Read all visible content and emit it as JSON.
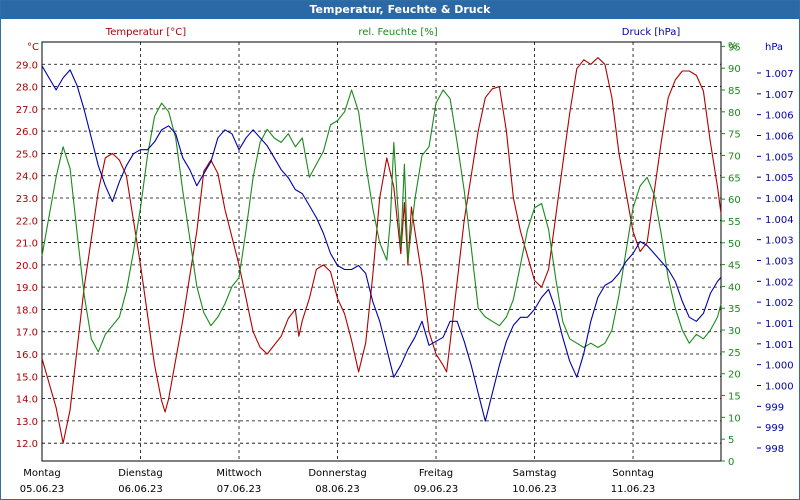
{
  "window": {
    "title": "Temperatur, Feuchte & Druck"
  },
  "colors": {
    "temperature": "#b00000",
    "humidity": "#1a8a1a",
    "pressure": "#0000aa",
    "grid": "#000000",
    "titlebar": "#2a69a5"
  },
  "chart_data": {
    "type": "line",
    "grid": true,
    "series": [
      {
        "name": "Temperatur [°C]",
        "axis": "left",
        "unit": "°C",
        "points": [
          [
            0,
            15.8
          ],
          [
            2,
            13.6
          ],
          [
            3,
            12.0
          ],
          [
            4,
            13.5
          ],
          [
            6,
            19.0
          ],
          [
            8,
            23.3
          ],
          [
            9,
            24.8
          ],
          [
            10,
            25.0
          ],
          [
            11,
            24.7
          ],
          [
            12,
            24.0
          ],
          [
            14,
            20.0
          ],
          [
            16,
            15.5
          ],
          [
            17,
            13.9
          ],
          [
            17.5,
            13.4
          ],
          [
            18,
            14.0
          ],
          [
            20,
            17.5
          ],
          [
            22,
            21.5
          ],
          [
            23,
            24.2
          ],
          [
            24,
            24.7
          ],
          [
            25,
            24.1
          ],
          [
            26,
            22.5
          ],
          [
            28,
            20.0
          ],
          [
            30,
            17.0
          ],
          [
            31,
            16.3
          ],
          [
            32,
            16.0
          ],
          [
            33,
            16.4
          ],
          [
            34,
            16.8
          ],
          [
            35,
            17.6
          ],
          [
            36,
            18.0
          ],
          [
            36.5,
            16.8
          ],
          [
            37,
            17.5
          ],
          [
            38,
            18.5
          ],
          [
            39,
            19.8
          ],
          [
            40,
            20.0
          ],
          [
            41,
            19.7
          ],
          [
            42,
            18.5
          ],
          [
            43,
            17.8
          ],
          [
            44,
            16.6
          ],
          [
            45,
            15.2
          ],
          [
            46,
            16.5
          ],
          [
            47,
            19.5
          ],
          [
            48,
            23.0
          ],
          [
            49,
            24.8
          ],
          [
            50,
            23.5
          ],
          [
            51,
            20.5
          ],
          [
            51.5,
            22.8
          ],
          [
            52,
            20.0
          ],
          [
            52.5,
            22.6
          ],
          [
            53,
            21.5
          ],
          [
            54,
            19.5
          ],
          [
            55,
            17.0
          ],
          [
            56,
            16.0
          ],
          [
            57,
            15.5
          ],
          [
            57.5,
            15.2
          ],
          [
            58,
            16.5
          ],
          [
            60,
            22.0
          ],
          [
            62,
            26.0
          ],
          [
            63,
            27.5
          ],
          [
            64,
            27.9
          ],
          [
            65,
            28.0
          ],
          [
            66,
            26.0
          ],
          [
            67,
            23.0
          ],
          [
            68,
            21.5
          ],
          [
            70,
            19.3
          ],
          [
            71,
            19.0
          ],
          [
            72,
            19.8
          ],
          [
            74,
            24.5
          ],
          [
            75,
            26.8
          ],
          [
            76,
            28.8
          ],
          [
            77,
            29.2
          ],
          [
            78,
            29.0
          ],
          [
            79,
            29.3
          ],
          [
            80,
            29.0
          ],
          [
            81,
            27.5
          ],
          [
            82,
            25.0
          ],
          [
            84,
            21.5
          ],
          [
            85,
            20.6
          ],
          [
            86,
            21.0
          ],
          [
            88,
            25.5
          ],
          [
            89,
            27.5
          ],
          [
            90,
            28.3
          ],
          [
            91,
            28.7
          ],
          [
            92,
            28.7
          ],
          [
            93,
            28.5
          ],
          [
            94,
            27.8
          ],
          [
            95,
            25.5
          ],
          [
            96,
            23.5
          ],
          [
            96.5,
            22.3
          ]
        ]
      },
      {
        "name": "rel. Feuchte [%]",
        "axis": "right1",
        "unit": "%",
        "points": [
          [
            0,
            47
          ],
          [
            1,
            56
          ],
          [
            2,
            65
          ],
          [
            3,
            72
          ],
          [
            4,
            67
          ],
          [
            5,
            52
          ],
          [
            6,
            38
          ],
          [
            7,
            28
          ],
          [
            8,
            25
          ],
          [
            9,
            29
          ],
          [
            10,
            31
          ],
          [
            11,
            33
          ],
          [
            12,
            39
          ],
          [
            13,
            48
          ],
          [
            14,
            58
          ],
          [
            15,
            70
          ],
          [
            16,
            79
          ],
          [
            17,
            82
          ],
          [
            18,
            80
          ],
          [
            19,
            74
          ],
          [
            20,
            62
          ],
          [
            21,
            51
          ],
          [
            22,
            40
          ],
          [
            23,
            34
          ],
          [
            24,
            31
          ],
          [
            25,
            33
          ],
          [
            26,
            36
          ],
          [
            27,
            40
          ],
          [
            28,
            42
          ],
          [
            29,
            53
          ],
          [
            30,
            65
          ],
          [
            31,
            73
          ],
          [
            32,
            76
          ],
          [
            33,
            74
          ],
          [
            34,
            73
          ],
          [
            35,
            75
          ],
          [
            36,
            72
          ],
          [
            37,
            74
          ],
          [
            38,
            65
          ],
          [
            39,
            68
          ],
          [
            40,
            71
          ],
          [
            41,
            77
          ],
          [
            42,
            78
          ],
          [
            43,
            80
          ],
          [
            44,
            85
          ],
          [
            45,
            80
          ],
          [
            46,
            68
          ],
          [
            47,
            58
          ],
          [
            48,
            50
          ],
          [
            49,
            46
          ],
          [
            49.5,
            55
          ],
          [
            50,
            73
          ],
          [
            50.5,
            60
          ],
          [
            51,
            49
          ],
          [
            51.5,
            68
          ],
          [
            52,
            46
          ],
          [
            53,
            60
          ],
          [
            54,
            70
          ],
          [
            55,
            72
          ],
          [
            56,
            82
          ],
          [
            57,
            85
          ],
          [
            58,
            83
          ],
          [
            59,
            73
          ],
          [
            60,
            62
          ],
          [
            61,
            49
          ],
          [
            62,
            35
          ],
          [
            63,
            33
          ],
          [
            64,
            32
          ],
          [
            65,
            31
          ],
          [
            66,
            33
          ],
          [
            67,
            37
          ],
          [
            68,
            45
          ],
          [
            69,
            53
          ],
          [
            70,
            58
          ],
          [
            71,
            59
          ],
          [
            72,
            53
          ],
          [
            73,
            42
          ],
          [
            74,
            32
          ],
          [
            75,
            28
          ],
          [
            76,
            27
          ],
          [
            77,
            26
          ],
          [
            78,
            27
          ],
          [
            79,
            26
          ],
          [
            80,
            27
          ],
          [
            81,
            30
          ],
          [
            82,
            38
          ],
          [
            83,
            48
          ],
          [
            84,
            58
          ],
          [
            85,
            63
          ],
          [
            86,
            65
          ],
          [
            87,
            61
          ],
          [
            88,
            52
          ],
          [
            89,
            42
          ],
          [
            90,
            35
          ],
          [
            91,
            30
          ],
          [
            92,
            27
          ],
          [
            93,
            29
          ],
          [
            94,
            28
          ],
          [
            95,
            30
          ],
          [
            96,
            33
          ],
          [
            96.5,
            36
          ]
        ]
      },
      {
        "name": "Druck [hPa]",
        "axis": "right2",
        "unit": "hPa",
        "points": [
          [
            0,
            1007.4
          ],
          [
            1,
            1007.1
          ],
          [
            2,
            1006.8
          ],
          [
            3,
            1007.1
          ],
          [
            4,
            1007.3
          ],
          [
            5,
            1006.9
          ],
          [
            6,
            1006.3
          ],
          [
            7,
            1005.6
          ],
          [
            8,
            1004.9
          ],
          [
            9,
            1004.4
          ],
          [
            10,
            1004.0
          ],
          [
            11,
            1004.5
          ],
          [
            12,
            1004.9
          ],
          [
            13,
            1005.2
          ],
          [
            14,
            1005.3
          ],
          [
            15,
            1005.3
          ],
          [
            16,
            1005.5
          ],
          [
            17,
            1005.8
          ],
          [
            18,
            1005.9
          ],
          [
            19,
            1005.7
          ],
          [
            20,
            1005.1
          ],
          [
            21,
            1004.8
          ],
          [
            22,
            1004.4
          ],
          [
            23,
            1004.7
          ],
          [
            24,
            1005.0
          ],
          [
            25,
            1005.6
          ],
          [
            26,
            1005.8
          ],
          [
            27,
            1005.7
          ],
          [
            28,
            1005.3
          ],
          [
            29,
            1005.6
          ],
          [
            30,
            1005.8
          ],
          [
            31,
            1005.6
          ],
          [
            32,
            1005.4
          ],
          [
            33,
            1005.1
          ],
          [
            34,
            1004.8
          ],
          [
            35,
            1004.6
          ],
          [
            36,
            1004.3
          ],
          [
            37,
            1004.2
          ],
          [
            38,
            1003.9
          ],
          [
            39,
            1003.6
          ],
          [
            40,
            1003.2
          ],
          [
            41,
            1002.7
          ],
          [
            42,
            1002.4
          ],
          [
            43,
            1002.3
          ],
          [
            44,
            1002.3
          ],
          [
            45,
            1002.4
          ],
          [
            46,
            1002.2
          ],
          [
            47,
            1001.5
          ],
          [
            48,
            1001.0
          ],
          [
            49,
            1000.3
          ],
          [
            50,
            999.6
          ],
          [
            51,
            999.9
          ],
          [
            52,
            1000.3
          ],
          [
            53,
            1000.6
          ],
          [
            54,
            1001.0
          ],
          [
            55,
            1000.4
          ],
          [
            56,
            1000.5
          ],
          [
            57,
            1000.6
          ],
          [
            58,
            1001.0
          ],
          [
            59,
            1001.0
          ],
          [
            60,
            1000.5
          ],
          [
            61,
            999.9
          ],
          [
            62,
            999.2
          ],
          [
            63,
            998.5
          ],
          [
            64,
            999.2
          ],
          [
            65,
            999.9
          ],
          [
            66,
            1000.5
          ],
          [
            67,
            1000.9
          ],
          [
            68,
            1001.1
          ],
          [
            69,
            1001.1
          ],
          [
            70,
            1001.3
          ],
          [
            71,
            1001.6
          ],
          [
            72,
            1001.8
          ],
          [
            73,
            1001.3
          ],
          [
            74,
            1000.6
          ],
          [
            75,
            1000.0
          ],
          [
            76,
            999.6
          ],
          [
            77,
            1000.2
          ],
          [
            78,
            1001.0
          ],
          [
            79,
            1001.6
          ],
          [
            80,
            1001.9
          ],
          [
            81,
            1002.0
          ],
          [
            82,
            1002.2
          ],
          [
            83,
            1002.5
          ],
          [
            84,
            1002.7
          ],
          [
            85,
            1003.0
          ],
          [
            86,
            1002.9
          ],
          [
            87,
            1002.7
          ],
          [
            88,
            1002.5
          ],
          [
            89,
            1002.3
          ],
          [
            90,
            1002.0
          ],
          [
            91,
            1001.5
          ],
          [
            92,
            1001.1
          ],
          [
            93,
            1001.0
          ],
          [
            94,
            1001.2
          ],
          [
            95,
            1001.7
          ],
          [
            96,
            1002.0
          ],
          [
            96.5,
            1002.1
          ]
        ]
      }
    ],
    "axes": {
      "x": {
        "range": [
          0,
          96.5
        ],
        "ticks": [
          0,
          14,
          28,
          42,
          56,
          70,
          84,
          96.5
        ],
        "day_labels": [
          "Montag",
          "Dienstag",
          "Mittwoch",
          "Donnerstag",
          "Freitag",
          "Samstag",
          "Sonntag"
        ],
        "date_labels": [
          "05.06.23",
          "06.06.23",
          "07.06.23",
          "08.06.23",
          "09.06.23",
          "10.06.23",
          "11.06.23"
        ]
      },
      "left": {
        "label": "Temperatur [°C]",
        "unit": "°C",
        "range": [
          11.2,
          30.0
        ],
        "ticks": [
          "12.0",
          "13.0",
          "14.0",
          "15.0",
          "16.0",
          "17.0",
          "18.0",
          "19.0",
          "20.0",
          "21.0",
          "22.0",
          "23.0",
          "24.0",
          "25.0",
          "26.0",
          "27.0",
          "28.0",
          "29.0"
        ]
      },
      "right1": {
        "label": "rel. Feuchte [%]",
        "unit": "%",
        "range": [
          0,
          96
        ],
        "ticks": [
          "0",
          "5",
          "10",
          "15",
          "20",
          "25",
          "30",
          "35",
          "40",
          "45",
          "50",
          "55",
          "60",
          "65",
          "70",
          "75",
          "80",
          "85",
          "90",
          "95"
        ]
      },
      "right2": {
        "label": "Druck [hPa]",
        "unit": "hPa",
        "range": [
          997.5,
          1008.0
        ],
        "ticks": [
          "998",
          "999",
          "999",
          "1.000",
          "1.000",
          "1.001",
          "1.001",
          "1.002",
          "1.002",
          "1.003",
          "1.003",
          "1.004",
          "1.004",
          "1.005",
          "1.005",
          "1.006",
          "1.006",
          "1.007",
          "1.007"
        ]
      }
    }
  }
}
